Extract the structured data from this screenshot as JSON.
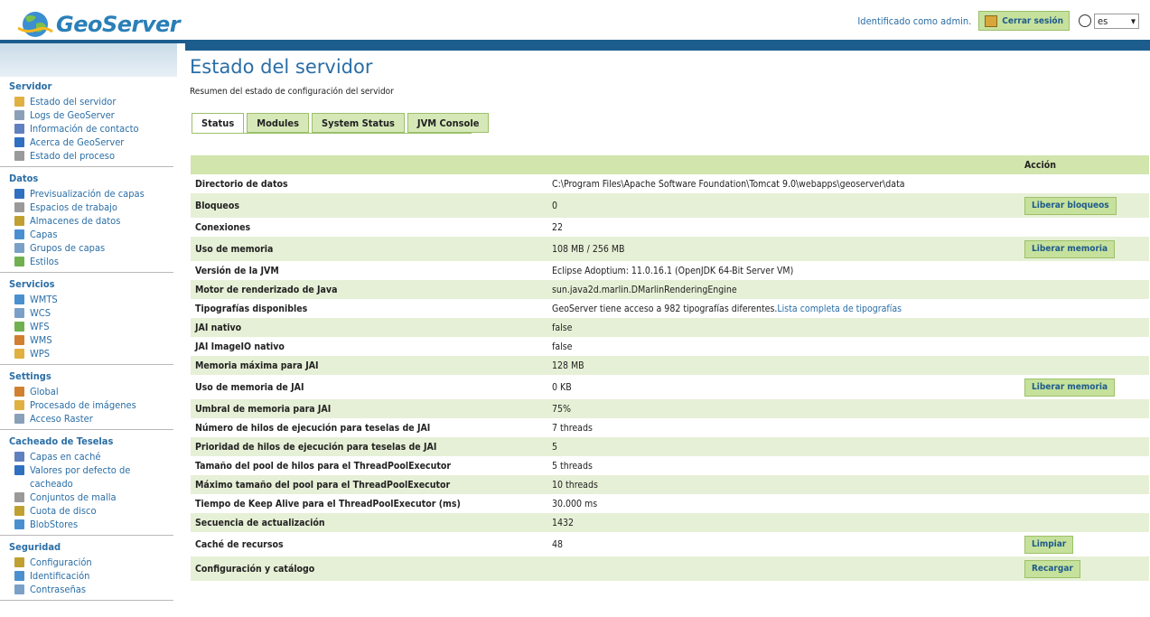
{
  "header": {
    "logo_text": "GeoServer",
    "auth_text": "Identificado como admin.",
    "logout_label": "Cerrar sesión",
    "lang_value": "es"
  },
  "sidebar": {
    "groups": [
      {
        "title": "Servidor",
        "items": [
          {
            "label": "Estado del servidor",
            "icon": "server-status-icon"
          },
          {
            "label": "Logs de GeoServer",
            "icon": "log-icon"
          },
          {
            "label": "Información de contacto",
            "icon": "contact-icon"
          },
          {
            "label": "Acerca de GeoServer",
            "icon": "about-icon"
          },
          {
            "label": "Estado del proceso",
            "icon": "process-icon"
          }
        ]
      },
      {
        "title": "Datos",
        "items": [
          {
            "label": "Previsualización de capas",
            "icon": "layer-preview-icon"
          },
          {
            "label": "Espacios de trabajo",
            "icon": "folder-icon"
          },
          {
            "label": "Almacenes de datos",
            "icon": "datastore-icon"
          },
          {
            "label": "Capas",
            "icon": "layers-icon"
          },
          {
            "label": "Grupos de capas",
            "icon": "layer-group-icon"
          },
          {
            "label": "Estilos",
            "icon": "styles-icon"
          }
        ]
      },
      {
        "title": "Servicios",
        "items": [
          {
            "label": "WMTS",
            "icon": "wmts-icon"
          },
          {
            "label": "WCS",
            "icon": "wcs-icon"
          },
          {
            "label": "WFS",
            "icon": "wfs-icon"
          },
          {
            "label": "WMS",
            "icon": "wms-icon"
          },
          {
            "label": "WPS",
            "icon": "wps-icon"
          }
        ]
      },
      {
        "title": "Settings",
        "items": [
          {
            "label": "Global",
            "icon": "global-icon"
          },
          {
            "label": "Procesado de imágenes",
            "icon": "image-processing-icon"
          },
          {
            "label": "Acceso Raster",
            "icon": "raster-access-icon"
          }
        ]
      },
      {
        "title": "Cacheado de Teselas",
        "items": [
          {
            "label": "Capas en caché",
            "icon": "cached-layers-icon"
          },
          {
            "label": "Valores por defecto de cacheado",
            "icon": "caching-defaults-icon"
          },
          {
            "label": "Conjuntos de malla",
            "icon": "gridsets-icon"
          },
          {
            "label": "Cuota de disco",
            "icon": "disk-quota-icon"
          },
          {
            "label": "BlobStores",
            "icon": "blobstores-icon"
          }
        ]
      },
      {
        "title": "Seguridad",
        "items": [
          {
            "label": "Configuración",
            "icon": "security-config-icon"
          },
          {
            "label": "Identificación",
            "icon": "authentication-icon"
          },
          {
            "label": "Contraseñas",
            "icon": "passwords-icon"
          }
        ]
      }
    ]
  },
  "main": {
    "title": "Estado del servidor",
    "description": "Resumen del estado de configuración del servidor",
    "tabs": [
      "Status",
      "Modules",
      "System Status",
      "JVM Console"
    ],
    "table_header_action": "Acción",
    "rows": [
      {
        "label": "Directorio de datos",
        "value": "C:\\Program Files\\Apache Software Foundation\\Tomcat 9.0\\webapps\\geoserver\\data",
        "action": ""
      },
      {
        "label": "Bloqueos",
        "value": "0",
        "action": "Liberar bloqueos"
      },
      {
        "label": "Conexiones",
        "value": "22",
        "action": ""
      },
      {
        "label": "Uso de memoria",
        "value": "108 MB / 256 MB",
        "action": "Liberar memoria"
      },
      {
        "label": "Versión de la JVM",
        "value": "Eclipse Adoptium: 11.0.16.1 (OpenJDK 64-Bit Server VM)",
        "action": ""
      },
      {
        "label": "Motor de renderizado de Java",
        "value": "sun.java2d.marlin.DMarlinRenderingEngine",
        "action": ""
      },
      {
        "label": "Tipografías disponibles",
        "value": "GeoServer tiene acceso a 982 tipografías diferentes.",
        "link": "Lista completa de tipografías",
        "action": ""
      },
      {
        "label": "JAI nativo",
        "value": "false",
        "action": ""
      },
      {
        "label": "JAI ImageIO nativo",
        "value": "false",
        "action": ""
      },
      {
        "label": "Memoria máxima para JAI",
        "value": "128 MB",
        "action": ""
      },
      {
        "label": "Uso de memoria de JAI",
        "value": "0 KB",
        "action": "Liberar memoria"
      },
      {
        "label": "Umbral de memoria para JAI",
        "value": "75%",
        "action": ""
      },
      {
        "label": "Número de hilos de ejecución para teselas de JAI",
        "value": "7 threads",
        "action": ""
      },
      {
        "label": "Prioridad de hilos de ejecución para teselas de JAI",
        "value": "5",
        "action": ""
      },
      {
        "label": "Tamaño del pool de hilos para el ThreadPoolExecutor",
        "value": "5 threads",
        "action": ""
      },
      {
        "label": "Máximo tamaño del pool para el ThreadPoolExecutor",
        "value": "10 threads",
        "action": ""
      },
      {
        "label": "Tiempo de Keep Alive para el ThreadPoolExecutor (ms)",
        "value": "30.000 ms",
        "action": ""
      },
      {
        "label": "Secuencia de actualización",
        "value": "1432",
        "action": ""
      },
      {
        "label": "Caché de recursos",
        "value": "48",
        "action": "Limpiar"
      },
      {
        "label": "Configuración y catálogo",
        "value": "",
        "action": "Recargar"
      }
    ]
  }
}
